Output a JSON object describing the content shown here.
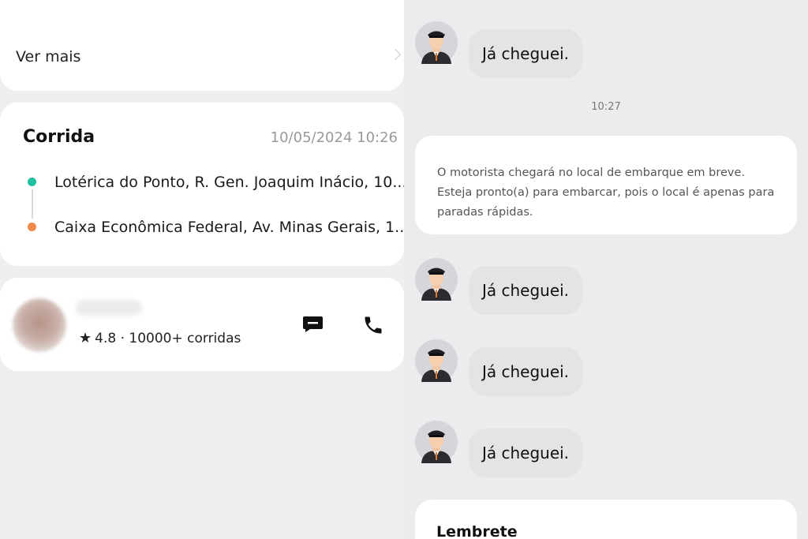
{
  "left": {
    "ver_mais": {
      "label": "Ver mais"
    },
    "trip": {
      "title": "Corrida",
      "datetime": "10/05/2024 10:26",
      "origin": "Lotérica do Ponto, R. Gen. Joaquim Inácio, 10...",
      "destination": "Caixa Econômica Federal, Av. Minas Gerais, 1..."
    },
    "driver": {
      "rating": "4.8",
      "separator": "·",
      "rides": "10000+ corridas"
    }
  },
  "chat": {
    "messages": [
      {
        "text": "Já cheguei."
      },
      {
        "text": "Já cheguei."
      },
      {
        "text": "Já cheguei."
      },
      {
        "text": "Já cheguei."
      }
    ],
    "timestamp": "10:27",
    "system_notice": {
      "line1": "O motorista chegará no local de embarque em breve.",
      "line2": "Esteja pronto(a) para embarcar, pois o local é apenas para",
      "line3": "paradas rápidas."
    },
    "reminder": {
      "title": "Lembrete"
    }
  },
  "colors": {
    "origin_dot": "#1fbf9f",
    "destination_dot": "#f08a4b",
    "bubble": "#e4e4e7"
  }
}
